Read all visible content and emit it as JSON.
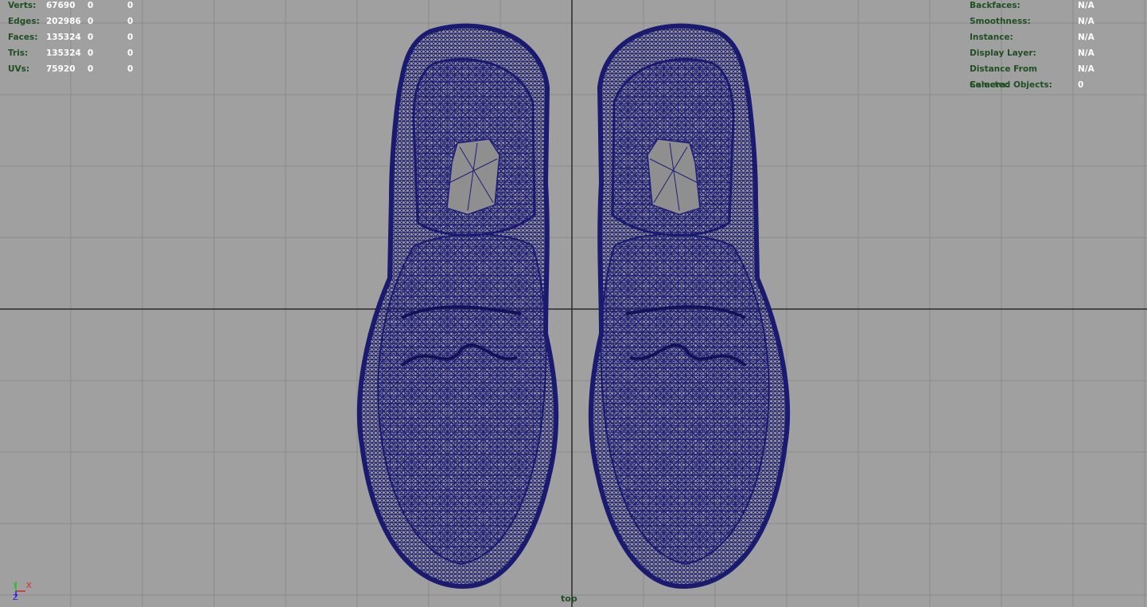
{
  "stats": [
    {
      "label": "Verts:",
      "v1": "67690",
      "v2": "0",
      "v3": "0"
    },
    {
      "label": "Edges:",
      "v1": "202986",
      "v2": "0",
      "v3": "0"
    },
    {
      "label": "Faces:",
      "v1": "135324",
      "v2": "0",
      "v3": "0"
    },
    {
      "label": "Tris:",
      "v1": "135324",
      "v2": "0",
      "v3": "0"
    },
    {
      "label": "UVs:",
      "v1": "75920",
      "v2": "0",
      "v3": "0"
    }
  ],
  "object_info": [
    {
      "label": "Backfaces:",
      "value": "N/A"
    },
    {
      "label": "Smoothness:",
      "value": "N/A"
    },
    {
      "label": "Instance:",
      "value": "N/A"
    },
    {
      "label": "Display Layer:",
      "value": "N/A"
    },
    {
      "label": "Distance From Camera:",
      "value": "N/A"
    },
    {
      "label": "Selected Objects:",
      "value": "0"
    }
  ],
  "camera": "top",
  "axes": {
    "x": "X",
    "y": "Y",
    "z": "Z"
  },
  "colors": {
    "background": "#a0a0a0",
    "grid": "#8a8a8a",
    "origin_axis": "#2a2a2a",
    "wireframe": "#1e1e7a",
    "label": "#1f4f23"
  }
}
